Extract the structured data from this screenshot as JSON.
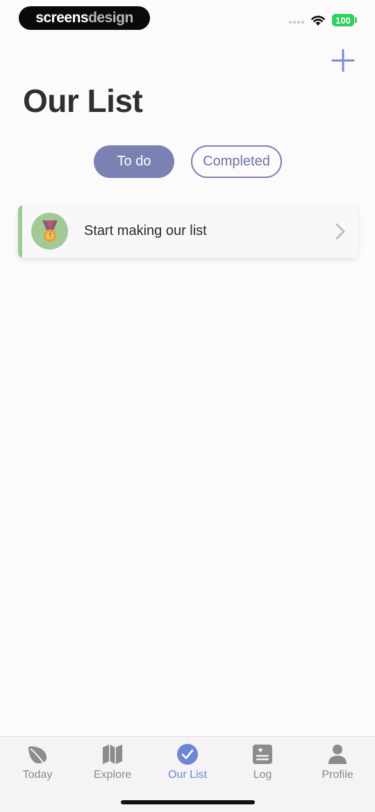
{
  "status_bar": {
    "brand_part1": "screens",
    "brand_part2": "design",
    "battery": "100"
  },
  "header": {
    "title": "Our List",
    "add_icon": "plus-icon"
  },
  "tabs": [
    {
      "label": "To do",
      "active": true
    },
    {
      "label": "Completed",
      "active": false
    }
  ],
  "list": {
    "items": [
      {
        "label": "Start making our list",
        "icon": "medal-icon",
        "accent": "#9fcb8f"
      }
    ]
  },
  "nav": {
    "items": [
      {
        "label": "Today",
        "icon": "leaf-icon",
        "active": false
      },
      {
        "label": "Explore",
        "icon": "map-icon",
        "active": false
      },
      {
        "label": "Our List",
        "icon": "check-circle-icon",
        "active": true
      },
      {
        "label": "Log",
        "icon": "journal-icon",
        "active": false
      },
      {
        "label": "Profile",
        "icon": "person-icon",
        "active": false
      }
    ]
  },
  "colors": {
    "accent": "#7b82b3",
    "nav_active": "#6f86d6",
    "card_accent": "#9fcb8f",
    "background": "#fcfafb"
  }
}
